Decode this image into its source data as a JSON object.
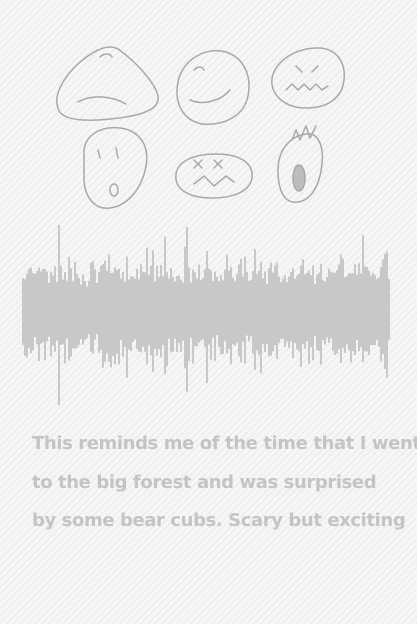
{
  "faces": [
    {
      "icon": "sad-face-icon"
    },
    {
      "icon": "smile-face-icon"
    },
    {
      "icon": "angry-face-icon"
    },
    {
      "icon": "shocked-face-icon"
    },
    {
      "icon": "dizzy-face-icon"
    },
    {
      "icon": "screaming-face-icon"
    }
  ],
  "waveform": {
    "color": "#c8c8c8"
  },
  "caption": {
    "lines": [
      "This reminds me of the time that I went",
      "to the big forest and was surprised",
      "by some bear cubs. Scary but exciting"
    ]
  }
}
